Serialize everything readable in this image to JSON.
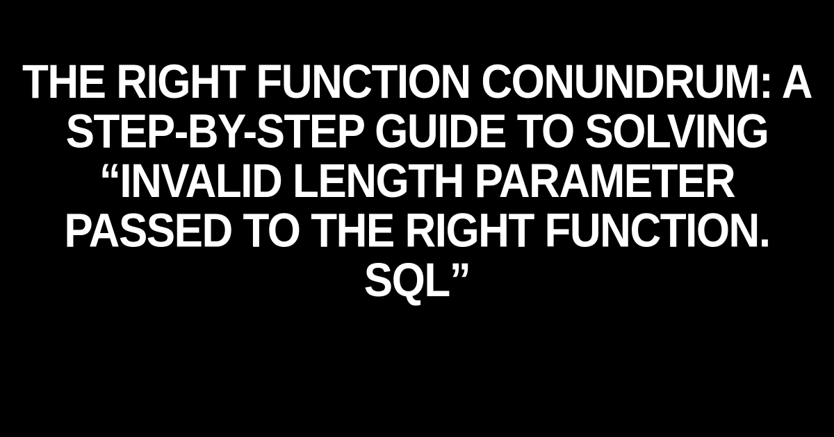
{
  "title": "The RIGHT Function Conundrum: A Step-by-Step Guide to Solving “Invalid length parameter passed to the RIGHT function. SQL”"
}
